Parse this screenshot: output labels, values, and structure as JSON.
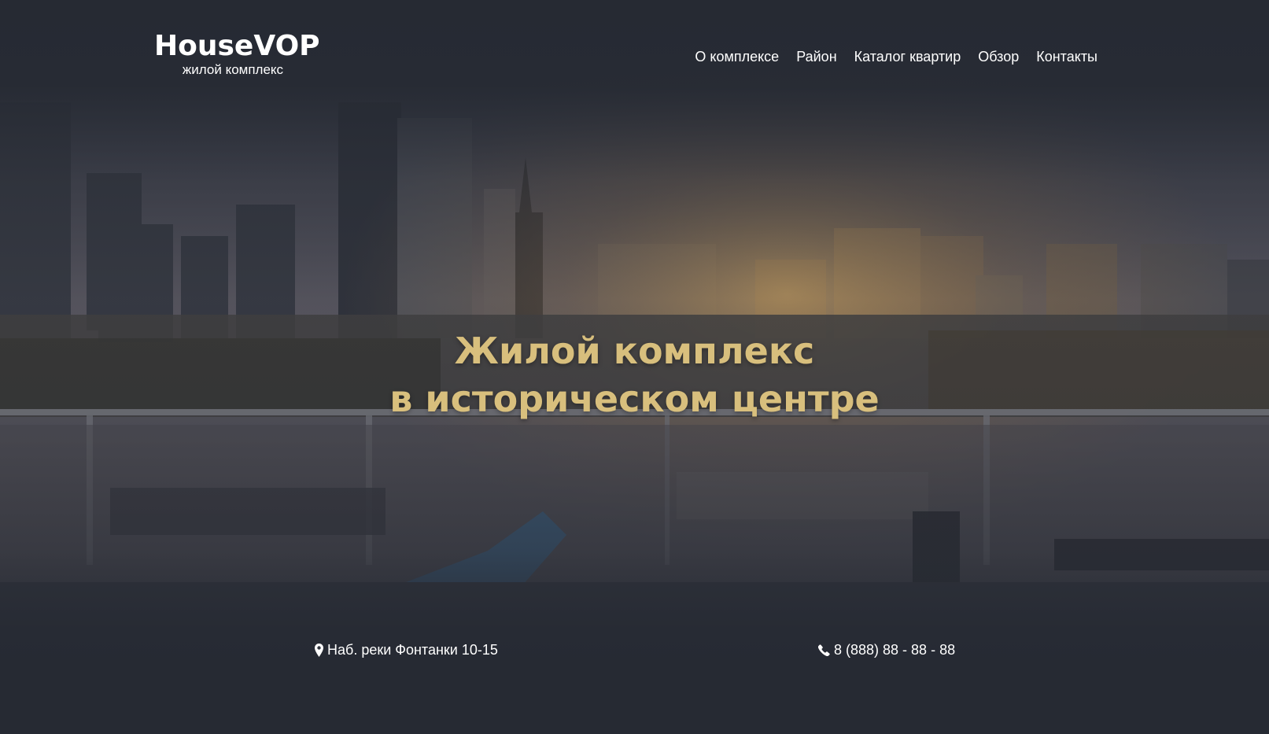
{
  "logo": {
    "title": "HouseVOP",
    "subtitle": "жилой комплекс"
  },
  "nav": {
    "items": [
      {
        "label": "О комплексе"
      },
      {
        "label": "Район"
      },
      {
        "label": "Каталог квартир"
      },
      {
        "label": "Обзор"
      },
      {
        "label": "Контакты"
      }
    ]
  },
  "hero": {
    "headline_line1": "Жилой комплекс",
    "headline_line2": "в историческом центре"
  },
  "contacts": {
    "address": "Наб. реки Фонтанки 10-15",
    "address_icon": "map-marker-icon",
    "phone": "8 (888) 88 - 88 - 88",
    "phone_icon": "phone-icon"
  },
  "colors": {
    "background": "#262a33",
    "headline": "#d8bf7d",
    "text": "#ffffff"
  }
}
